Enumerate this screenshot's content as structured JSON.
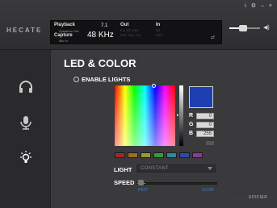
{
  "window": {
    "logo": "HECATE",
    "controls": [
      "i",
      "⚙",
      "–",
      "×"
    ]
  },
  "status": {
    "playback_label": "Playback",
    "playback_device": "Speakers Out",
    "capture_label": "Capture",
    "capture_device": "Mic In",
    "channels": "7.1",
    "sample_rate": "48",
    "sample_unit": "KHz",
    "out_label": "Out",
    "in_label": "In",
    "out_codes": [
      "EQ  SB  SBS",
      "SBF  SBL  EQ"
    ],
    "in_codes": [
      "NS",
      "ENC"
    ]
  },
  "volume": {
    "level": 0.35
  },
  "sidebar": {
    "items": [
      {
        "name": "headphones"
      },
      {
        "name": "microphone"
      },
      {
        "name": "led",
        "active": true
      }
    ]
  },
  "main": {
    "title": "LED & COLOR",
    "enable_lights_label": "ENABLE LIGHTS",
    "color": {
      "r": "0",
      "g": "0",
      "b": "255",
      "hex": "#1d3fb0"
    },
    "presets": [
      "#a02828",
      "#a06a20",
      "#9a9a2a",
      "#3a9a3a",
      "#2a8a9a",
      "#2a4aa8",
      "#8a3a9a"
    ],
    "light": {
      "label": "LIGHT",
      "value": "CONSTANT"
    },
    "speed": {
      "label": "SPEED",
      "fast": "FAST",
      "slow": "SLOW",
      "level": 0.1
    },
    "brand": {
      "sub": "Powered by",
      "main": "EDIFIER"
    }
  }
}
